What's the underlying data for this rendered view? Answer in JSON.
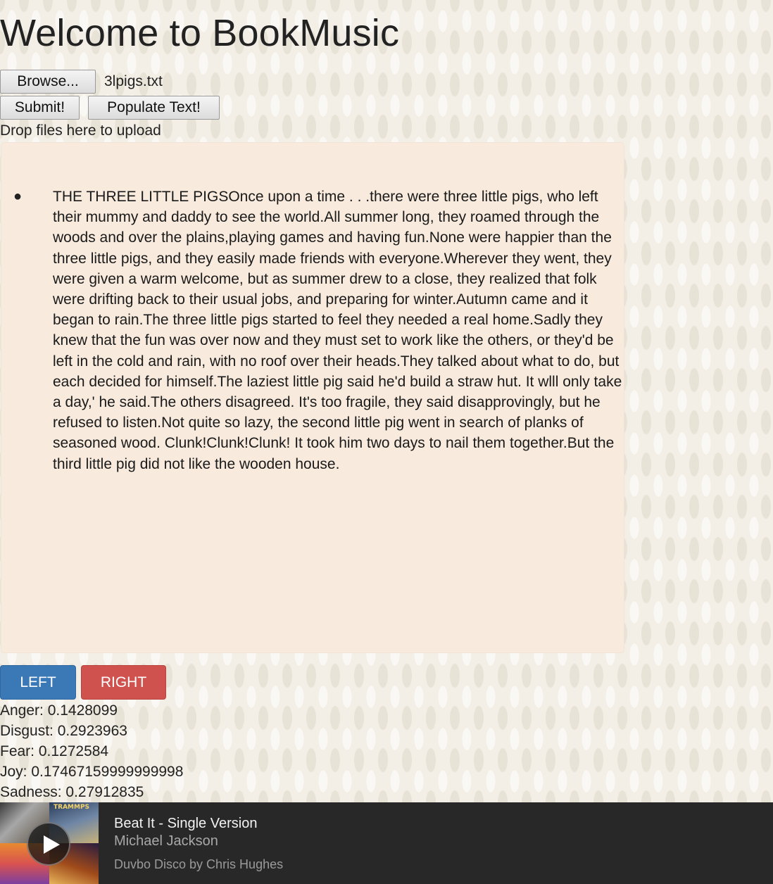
{
  "page": {
    "title": "Welcome to BookMusic"
  },
  "upload": {
    "browse_label": "Browse...",
    "file_name": "3lpigs.txt",
    "submit_label": "Submit!",
    "populate_label": "Populate Text!",
    "drop_hint": "Drop files here to upload"
  },
  "text_panel": {
    "story": "THE THREE LITTLE PIGSOnce upon a time . . .there were three little pigs, who left their mummy and daddy to see the world.All summer long, they roamed through the woods and over the plains,playing games and having fun.None were happier than the three little pigs, and they easily made friends with everyone.Wherever they went, they were given a warm welcome, but as summer drew to a close, they realized that folk were drifting back to their usual jobs, and preparing for winter.Autumn came and it began to rain.The three little pigs started to feel they needed a real home.Sadly they knew that the fun was over now and they must set to work like the others, or they'd be left in the cold and rain, with no roof over their heads.They talked about what to do, but each decided for himself.The laziest little pig said he'd build a straw hut. It wlll only take a day,' he said.The others disagreed. It's too fragile, they said disapprovingly, but he refused to listen.Not quite so lazy, the second little pig went in search of planks of seasoned wood. Clunk!Clunk!Clunk! It took him two days to nail them together.But the third little pig did not like the wooden house."
  },
  "nav": {
    "left_label": "LEFT",
    "right_label": "RIGHT"
  },
  "emotions": [
    {
      "text": "Anger: 0.1428099"
    },
    {
      "text": "Disgust: 0.2923963"
    },
    {
      "text": "Fear: 0.1272584"
    },
    {
      "text": "Joy: 0.17467159999999998"
    },
    {
      "text": "Sadness: 0.27912835"
    }
  ],
  "player": {
    "track_title": "Beat It - Single Version",
    "artist": "Michael Jackson",
    "playlist": "Duvbo Disco by Chris Hughes",
    "art_label": "TRAMMPS",
    "colors": {
      "background": "#282828",
      "left_button": "#3a78b6",
      "right_button": "#cf524e",
      "panel": "#f8ebde"
    }
  }
}
